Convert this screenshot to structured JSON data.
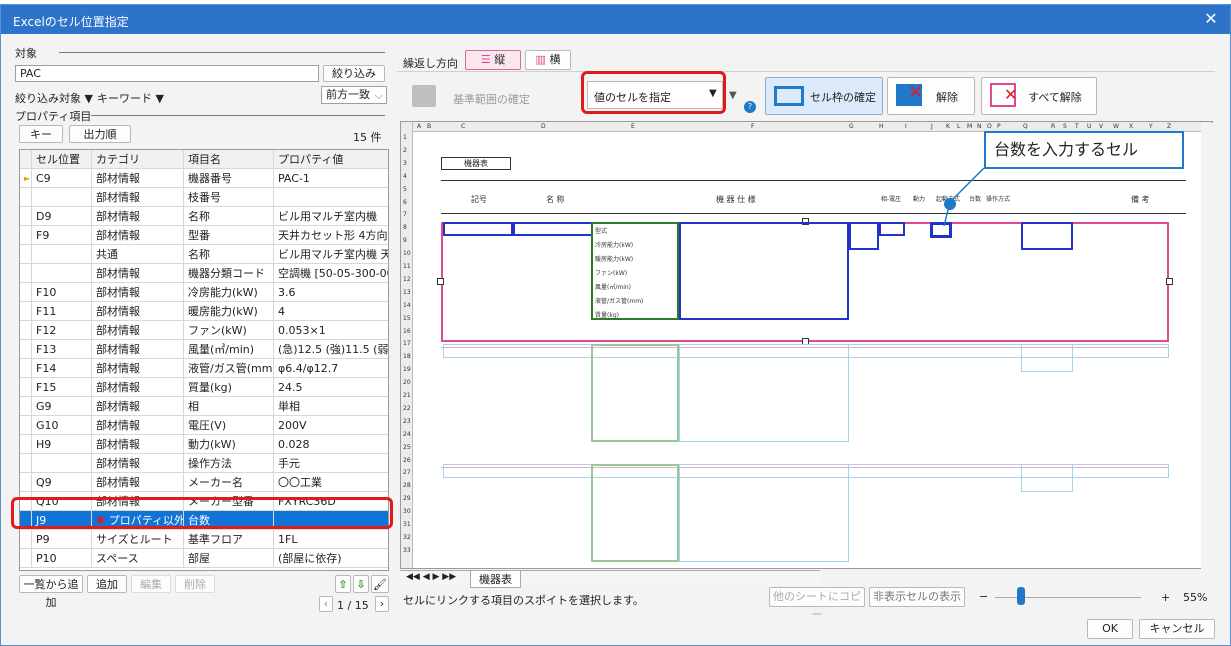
{
  "dialog": {
    "title": "Excelのセル位置指定",
    "close_icon": "close-icon"
  },
  "left": {
    "target_label": "対象",
    "target_value": "PAC",
    "filter_button": "絞り込み",
    "filter_target": "絞り込み対象 ▼",
    "keyword": "キーワード ▼",
    "match_mode": "前方一致",
    "property_label": "プロパティ項目",
    "key_button": "キー",
    "output_order_button": "出力順",
    "count": "15 件",
    "columns": [
      "セル位置",
      "カテゴリ",
      "項目名",
      "プロパティ値"
    ],
    "rows": [
      [
        "C9",
        "部材情報",
        "機器番号",
        "PAC-1"
      ],
      [
        "",
        "部材情報",
        "枝番号",
        ""
      ],
      [
        "D9",
        "部材情報",
        "名称",
        "ビル用マルチ室内機"
      ],
      [
        "F9",
        "部材情報",
        "型番",
        "天井カセット形 4方向"
      ],
      [
        "",
        "共通",
        "名称",
        "ビル用マルチ室内機 天..."
      ],
      [
        "",
        "部材情報",
        "機器分類コード",
        "空調機 [50-05-300-00..."
      ],
      [
        "F10",
        "部材情報",
        "冷房能力(kW)",
        "3.6"
      ],
      [
        "F11",
        "部材情報",
        "暖房能力(kW)",
        "4"
      ],
      [
        "F12",
        "部材情報",
        "ファン(kW)",
        "0.053×1"
      ],
      [
        "F13",
        "部材情報",
        "風量(㎥/min)",
        "(急)12.5 (強)11.5 (弱)..."
      ],
      [
        "F14",
        "部材情報",
        "液管/ガス管(mm)",
        "φ6.4/φ12.7"
      ],
      [
        "F15",
        "部材情報",
        "質量(kg)",
        "24.5"
      ],
      [
        "G9",
        "部材情報",
        "相",
        "単相"
      ],
      [
        "G10",
        "部材情報",
        "電圧(V)",
        "200V"
      ],
      [
        "H9",
        "部材情報",
        "動力(kW)",
        "0.028"
      ],
      [
        "",
        "部材情報",
        "操作方法",
        "手元"
      ],
      [
        "Q9",
        "部材情報",
        "メーカー名",
        "〇〇工業"
      ],
      [
        "Q10",
        "部材情報",
        "メーカー型番",
        "FXYRC36D"
      ],
      [
        "J9",
        "プロパティ以外の...",
        "台数",
        ""
      ],
      [
        "P9",
        "サイズとルート",
        "基準フロア",
        "1FL"
      ],
      [
        "P10",
        "スペース",
        "部屋",
        "(部屋に依存)"
      ]
    ],
    "add_from_list": "一覧から追加",
    "add": "追加",
    "edit": "編集",
    "delete": "削除",
    "page": "1 / 15"
  },
  "right": {
    "repeat_direction": "繰返し方向",
    "vertical": "縦",
    "horizontal": "横",
    "confirm_range": "基準範囲の確定",
    "cell_mode": "値のセルを指定",
    "confirm_cell_border": "セル枠の確定",
    "release": "解除",
    "release_all": "すべて解除",
    "callout": "台数を入力するセル",
    "sheet_title": "機器表",
    "col_labels": [
      "A",
      "B",
      "C",
      "D",
      "E",
      "F",
      "G",
      "H",
      "I",
      "J",
      "K",
      "L",
      "M",
      "N",
      "O",
      "P",
      "Q",
      "R",
      "S",
      "T",
      "U",
      "V",
      "W",
      "X",
      "Y",
      "Z"
    ],
    "header_cells": [
      "記号",
      "名 称",
      "機 器 仕 様",
      "相-電圧",
      "動力",
      "起動方式",
      "台数",
      "操作方式",
      "備 考"
    ],
    "spec_labels": [
      "型式",
      "冷房能力(kW)",
      "暖房能力(kW)",
      "ファン(kW)",
      "風量(㎥/min)",
      "液管/ガス管(mm)",
      "質量(kg)"
    ],
    "sheet_tab": "機器表",
    "status": "セルにリンクする項目のスポイトを選択します。",
    "copy_other_sheet": "他のシートにコピー",
    "show_hidden": "非表示セルの表示",
    "zoom_minus": "−",
    "zoom_plus": "+",
    "zoom": "55%",
    "ok": "OK",
    "cancel": "キャンセル"
  }
}
